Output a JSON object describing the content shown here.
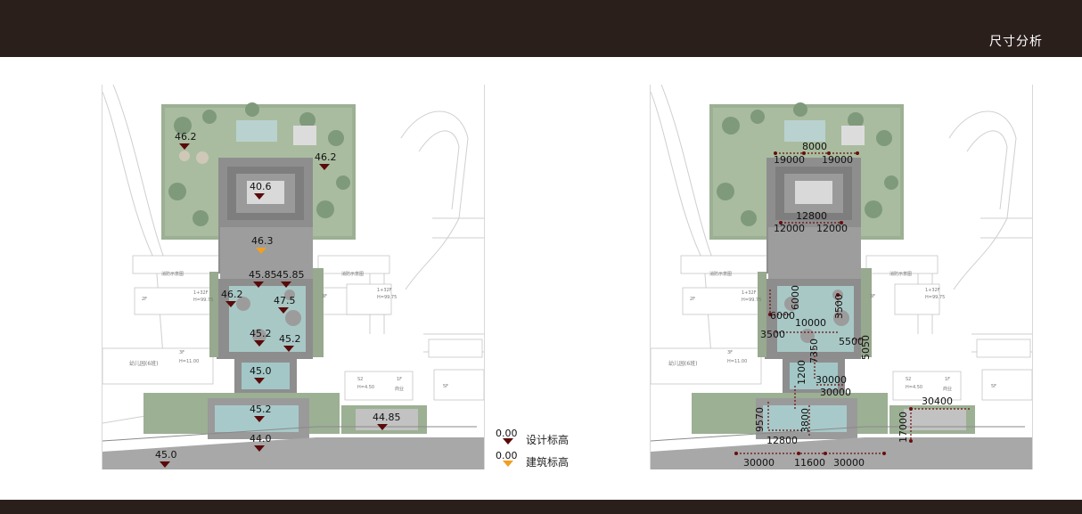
{
  "header": {
    "title": "尺寸分析"
  },
  "legend": [
    {
      "value": "0.00",
      "label": "设计标高",
      "color": "#5a0a0a"
    },
    {
      "value": "0.00",
      "label": "建筑标高",
      "color": "#f0a020"
    }
  ],
  "left_plan": {
    "elevations": [
      {
        "value": "46.2",
        "kind": "design"
      },
      {
        "value": "46.2",
        "kind": "design"
      },
      {
        "value": "40.6",
        "kind": "design"
      },
      {
        "value": "46.3",
        "kind": "building"
      },
      {
        "value": "45.85",
        "kind": "design"
      },
      {
        "value": "45.85",
        "kind": "design"
      },
      {
        "value": "46.2",
        "kind": "design"
      },
      {
        "value": "47.5",
        "kind": "design"
      },
      {
        "value": "45.2",
        "kind": "design"
      },
      {
        "value": "45.2",
        "kind": "design"
      },
      {
        "value": "45.0",
        "kind": "design"
      },
      {
        "value": "45.2",
        "kind": "design"
      },
      {
        "value": "44.85",
        "kind": "design"
      },
      {
        "value": "44.0",
        "kind": "design"
      },
      {
        "value": "45.0",
        "kind": "design"
      }
    ]
  },
  "right_plan": {
    "dimensions": [
      "8000",
      "19000",
      "19000",
      "12800",
      "12000",
      "12000",
      "6000",
      "3500",
      "6000",
      "10000",
      "3500",
      "5500",
      "5050",
      "7350",
      "1200",
      "30000",
      "30000",
      "30400",
      "9570",
      "3800",
      "17000",
      "12800",
      "30000",
      "11600",
      "30000"
    ]
  },
  "plan_annotations": {
    "bldg_3f_a": "3F",
    "bldg_3f_b": "3F",
    "bldg_32f": "1+32F",
    "bldg_height": "H=99.75",
    "bldg_2f": "2F",
    "kindergarten": "幼儿园(6班)",
    "kindergarten_floors": "3F",
    "kindergarten_height": "H=11.00",
    "shop_code": "S2",
    "shop_floors": "1F",
    "shop_height": "H=4.50",
    "shop_use": "商业",
    "bldg_5f": "5F"
  }
}
